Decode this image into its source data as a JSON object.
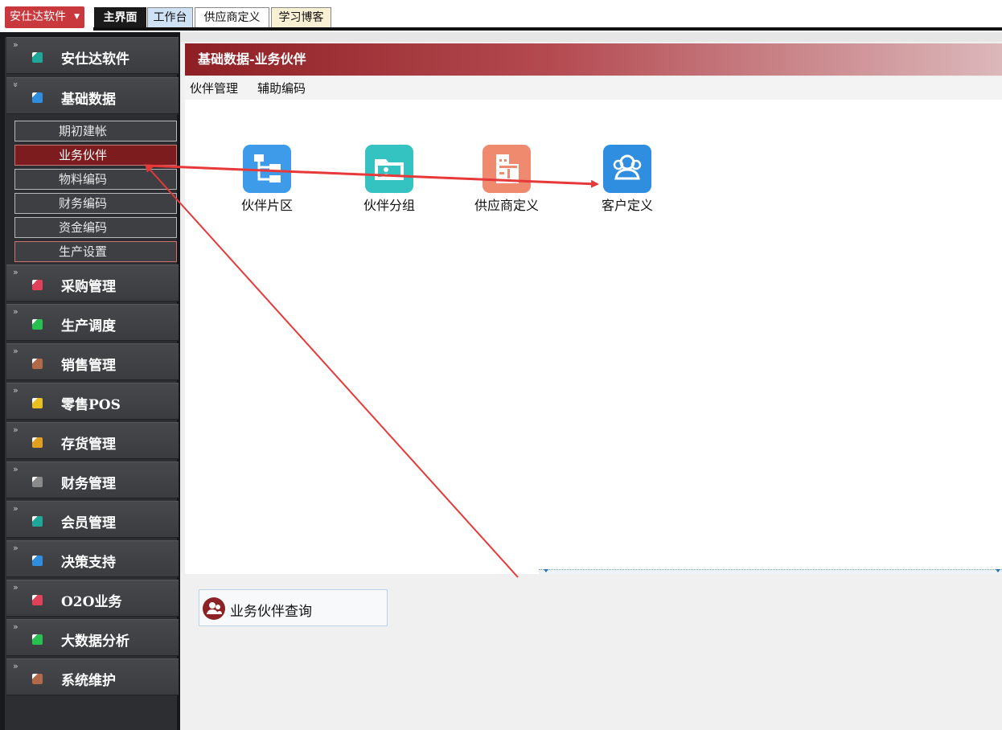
{
  "top": {
    "app_menu": "安仕达软件",
    "tabs": [
      {
        "label": "主界面"
      },
      {
        "label": "工作台"
      },
      {
        "label": "供应商定义"
      },
      {
        "label": "学习博客"
      }
    ]
  },
  "sidebar": {
    "groups": [
      {
        "label": "安仕达软件",
        "color": "#1fa89a"
      },
      {
        "label": "基础数据",
        "color": "#2f8ee0"
      },
      {
        "label": "采购管理",
        "color": "#e0405a"
      },
      {
        "label": "生产调度",
        "color": "#28c050"
      },
      {
        "label": "销售管理",
        "color": "#b06a4a"
      },
      {
        "label": "零售POS",
        "color": "#e8c020"
      },
      {
        "label": "存货管理",
        "color": "#e0a020"
      },
      {
        "label": "财务管理",
        "color": "#8a8a8a"
      },
      {
        "label": "会员管理",
        "color": "#1fa89a"
      },
      {
        "label": "决策支持",
        "color": "#2f8ee0"
      },
      {
        "label": "O2O业务",
        "color": "#e0405a"
      },
      {
        "label": "大数据分析",
        "color": "#28c050"
      },
      {
        "label": "系统维护",
        "color": "#b06a4a"
      }
    ],
    "sub_items": [
      {
        "label": "期初建帐"
      },
      {
        "label": "业务伙伴"
      },
      {
        "label": "物料编码"
      },
      {
        "label": "财务编码"
      },
      {
        "label": "资金编码"
      },
      {
        "label": "生产设置"
      }
    ]
  },
  "main": {
    "title": "基础数据-业务伙伴",
    "menu": [
      {
        "label": "伙伴管理"
      },
      {
        "label": "辅助编码"
      }
    ],
    "tiles": [
      {
        "label": "伙伴片区",
        "icon": "org-chart-icon",
        "color": "#3d9be9"
      },
      {
        "label": "伙伴分组",
        "icon": "folder-icon",
        "color": "#35c3c2"
      },
      {
        "label": "供应商定义",
        "icon": "building-icon",
        "color": "#ef8a6e"
      },
      {
        "label": "客户定义",
        "icon": "users-icon",
        "color": "#2f8ee0"
      }
    ],
    "query": {
      "label": "业务伙伴查询",
      "icon": "partner-icon"
    }
  }
}
